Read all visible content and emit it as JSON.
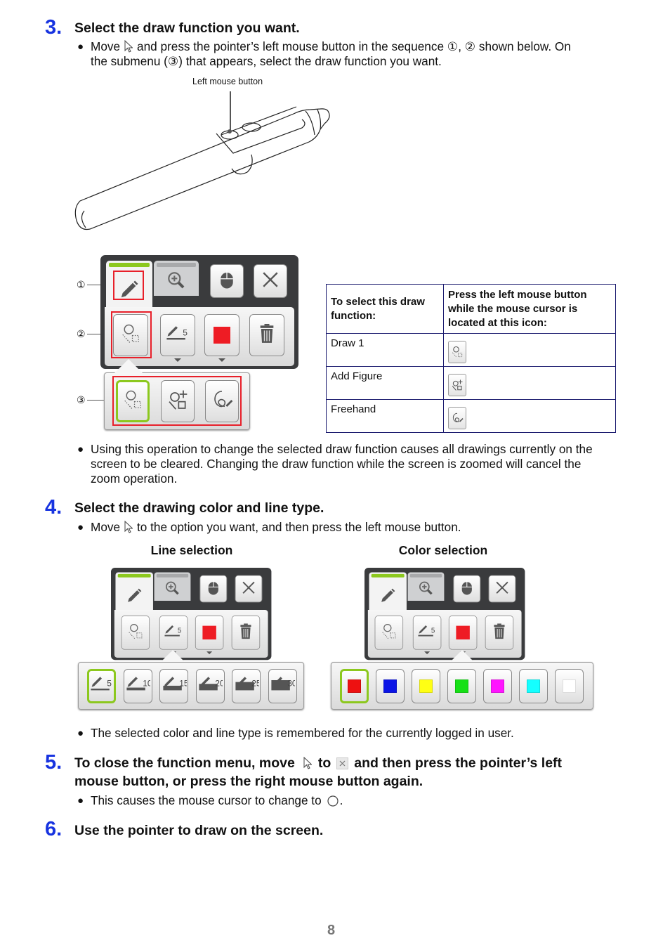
{
  "step3": {
    "number": "3.",
    "heading": "Select the draw function you want.",
    "bullet_mark": "●",
    "move": "Move",
    "line1": "and press the pointer’s left mouse button in the sequence ①, ② shown below. On",
    "line2": "the submenu (③) that appears, select the draw function you want.",
    "callout_label": "Left mouse button",
    "markers": [
      "①",
      "②",
      "③"
    ],
    "table": {
      "headers": [
        "To select this draw function:",
        "Press the left mouse button while the mouse cursor is located at this icon:"
      ],
      "rows": [
        {
          "function": "Draw 1",
          "icon": "draw1-icon"
        },
        {
          "function": "Add Figure",
          "icon": "add-figure-icon"
        },
        {
          "function": "Freehand",
          "icon": "freehand-icon"
        }
      ]
    },
    "note_lines": [
      "Using this operation to change the selected draw function causes all drawings currently on the",
      "screen to be cleared. Changing the draw function while the screen is zoomed will cancel the",
      "zoom operation."
    ]
  },
  "toolbar": {
    "line_width": "5",
    "color": "#ee1c24",
    "accent": "#8cc81e"
  },
  "step4": {
    "number": "4.",
    "heading": "Select the drawing color and line type.",
    "move": "Move",
    "text": "to the option you want, and then press the left mouse button.",
    "line_label": "Line selection",
    "color_label": "Color selection",
    "line_widths": [
      "5",
      "10",
      "15",
      "20",
      "25",
      "30"
    ],
    "colors": [
      "#ee1111",
      "#0b14e6",
      "#ffff14",
      "#16e016",
      "#ff14ff",
      "#14ffff",
      "#ffffff"
    ],
    "note": "The selected color and line type is remembered for the currently logged in user."
  },
  "step5": {
    "number": "5.",
    "heading_a": "To close the function menu, move",
    "heading_b": "to",
    "heading_c": "and then press the pointer’s left",
    "heading_line2": "mouse button, or press the right mouse button again.",
    "note_a": "This causes the mouse cursor to change to",
    "note_b": "."
  },
  "step6": {
    "number": "6.",
    "heading": "Use the pointer to draw on the screen."
  },
  "page_number": "8"
}
